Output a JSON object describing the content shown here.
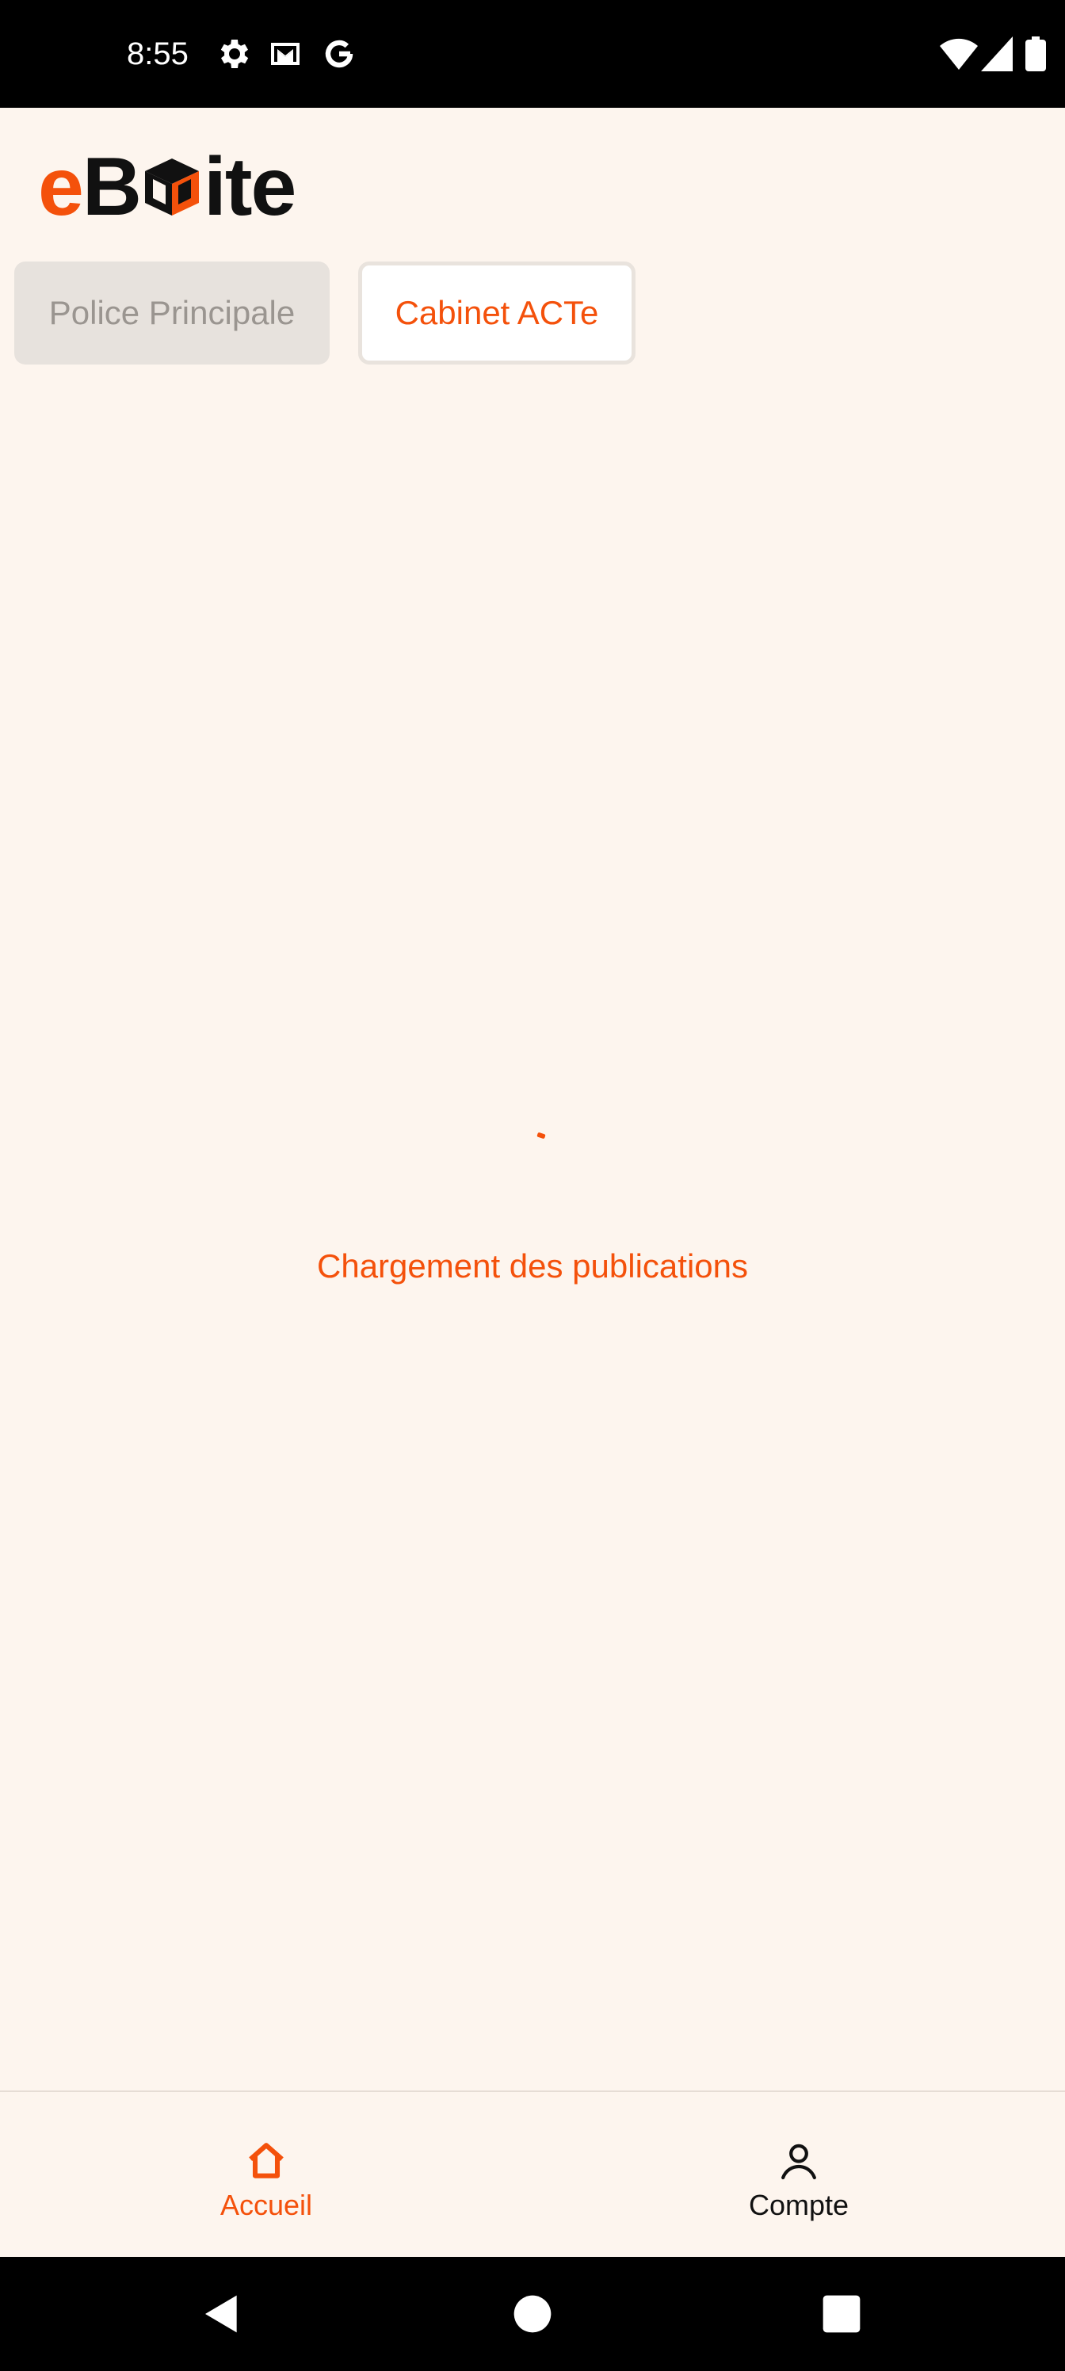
{
  "status_bar": {
    "time": "8:55",
    "left_icons": [
      "gear-icon",
      "gmail-icon",
      "google-icon"
    ],
    "right_icons": [
      "wifi-icon",
      "signal-icon",
      "battery-icon"
    ]
  },
  "app": {
    "logo": {
      "e": "e",
      "b": "B",
      "ite": "ite"
    },
    "brand_color": "#f4510b"
  },
  "tabs": [
    {
      "label": "Police Principale",
      "state": "disabled"
    },
    {
      "label": "Cabinet ACTe",
      "state": "selected"
    }
  ],
  "loading": {
    "text": "Chargement des publications"
  },
  "bottom_nav": [
    {
      "label": "Accueil",
      "icon": "home-icon",
      "active": true
    },
    {
      "label": "Compte",
      "icon": "user-icon",
      "active": false
    }
  ],
  "system_nav": [
    "back-icon",
    "home-circle-icon",
    "recents-icon"
  ]
}
